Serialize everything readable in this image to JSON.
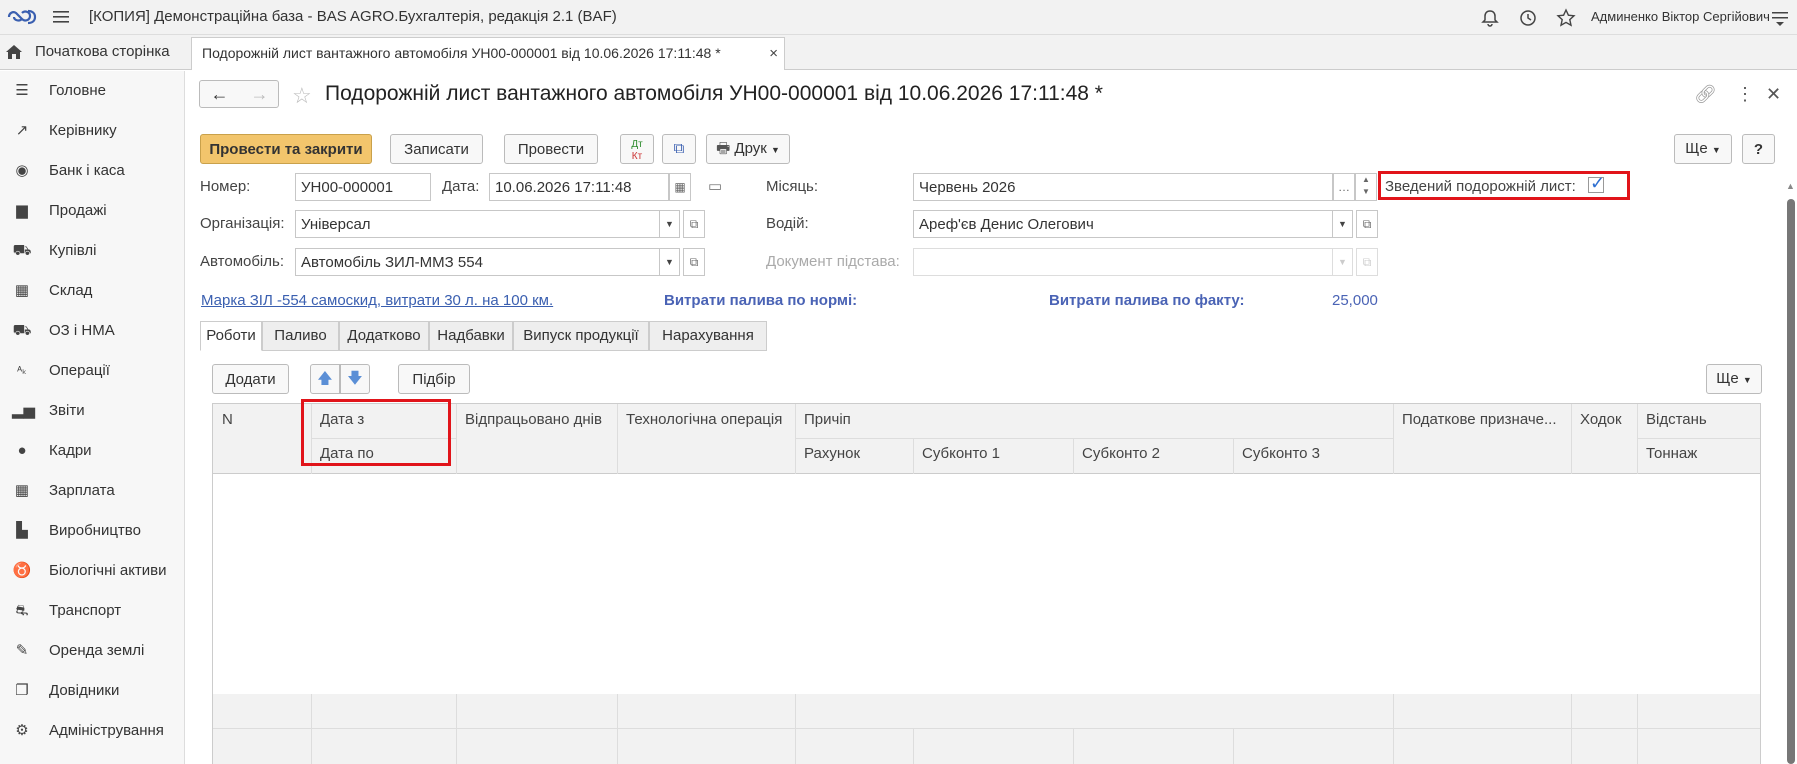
{
  "app": {
    "title": "[КОПИЯ] Демонстраційна база - BAS AGRO.Бухгалтерія, редакція 2.1  (BAF)",
    "user": "Админенко Віктор Сергійович"
  },
  "tabs": {
    "home_label": "Початкова сторінка",
    "doc_label": "Подорожній лист вантажного автомобіля УН00-000001 від 10.06.2026 17:11:48 *",
    "close_glyph": "×"
  },
  "sidebar": {
    "items": [
      {
        "label": "Головне",
        "icon": "list-icon"
      },
      {
        "label": "Керівнику",
        "icon": "trend-icon"
      },
      {
        "label": "Банк і каса",
        "icon": "coins-icon"
      },
      {
        "label": "Продажі",
        "icon": "bag-icon"
      },
      {
        "label": "Купівлі",
        "icon": "cart-icon"
      },
      {
        "label": "Склад",
        "icon": "warehouse-icon"
      },
      {
        "label": "ОЗ і НМА",
        "icon": "truck-icon"
      },
      {
        "label": "Операції",
        "icon": "dt-kt-icon"
      },
      {
        "label": "Звіти",
        "icon": "bar-chart-icon"
      },
      {
        "label": "Кадри",
        "icon": "person-icon"
      },
      {
        "label": "Зарплата",
        "icon": "calculator-icon"
      },
      {
        "label": "Виробництво",
        "icon": "factory-icon"
      },
      {
        "label": "Біологічні активи",
        "icon": "cow-icon"
      },
      {
        "label": "Транспорт",
        "icon": "tractor-icon"
      },
      {
        "label": "Оренда землі",
        "icon": "feather-icon"
      },
      {
        "label": "Довідники",
        "icon": "books-icon"
      },
      {
        "label": "Адміністрування",
        "icon": "gear-icon"
      }
    ]
  },
  "form": {
    "title": "Подорожній лист вантажного автомобіля УН00-000001 від 10.06.2026 17:11:48 *",
    "buttons": {
      "post_close": "Провести та закрити",
      "save": "Записати",
      "post": "Провести",
      "print": "Друк",
      "more": "Ще",
      "help": "?"
    },
    "fields": {
      "number_label": "Номер:",
      "number_value": "УН00-000001",
      "date_label": "Дата:",
      "date_value": "10.06.2026 17:11:48",
      "month_label": "Місяць:",
      "month_value": "Червень 2026",
      "summary_label": "Зведений подорожній лист:",
      "summary_checked": true,
      "org_label": "Організація:",
      "org_value": "Універсал",
      "driver_label": "Водій:",
      "driver_value": "Ареф'єв Денис Олегович",
      "car_label": "Автомобіль:",
      "car_value": "Автомобіль ЗИЛ-ММЗ  554",
      "basis_label": "Документ підстава:",
      "basis_value": ""
    },
    "info": {
      "brand_link": "Марка ЗІЛ -554 самоскид, витрати 30 л. на 100 км.",
      "fuel_norm_label": "Витрати палива по нормі:",
      "fuel_fact_label": "Витрати палива по факту:",
      "fuel_fact_value": "25,000"
    },
    "tabs": [
      "Роботи",
      "Паливо",
      "Додатково",
      "Надбавки",
      "Випуск продукції",
      "Нарахування"
    ],
    "table_toolbar": {
      "add": "Додати",
      "select": "Підбір",
      "more": "Ще"
    },
    "table": {
      "columns": {
        "n": "N",
        "date_from": "Дата з",
        "date_to": "Дата по",
        "days": "Відпрацьовано днів",
        "operation": "Технологічна операція",
        "other": "Причіп",
        "account": "Рахунок",
        "sub1": "Субконто 1",
        "sub2": "Субконто 2",
        "sub3": "Субконто 3",
        "tax": "Податкове призначе...",
        "trips": "Ходок",
        "distance": "Відстань",
        "tonnage": "Тоннаж"
      },
      "rows": []
    }
  },
  "colors": {
    "primary_button": "#f2c56c",
    "highlight": "#e1141a",
    "link": "#3a5fb0",
    "info_blue": "#4a63b5"
  }
}
